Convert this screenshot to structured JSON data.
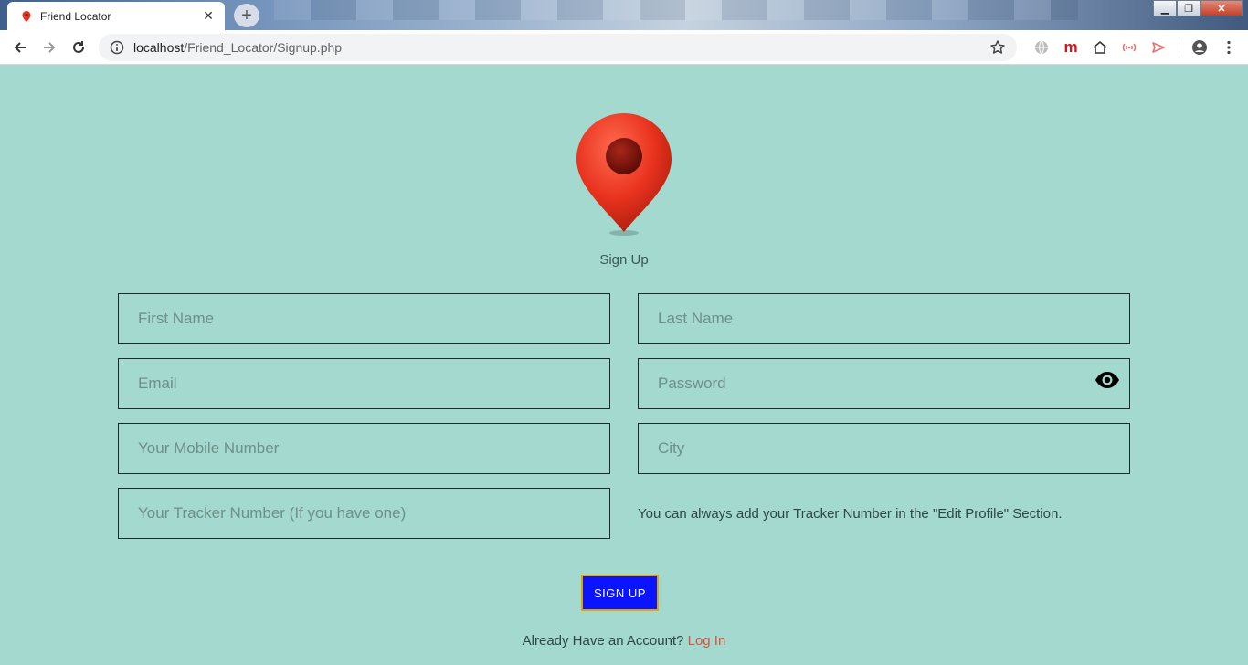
{
  "browser": {
    "tab_title": "Friend Locator",
    "tab_close": "✕",
    "new_tab": "+",
    "url_host": "localhost",
    "url_path": "/Friend_Locator/Signup.php",
    "extension_m_label": "m"
  },
  "page": {
    "heading": "Sign Up",
    "fields": {
      "first_name": "First Name",
      "last_name": "Last Name",
      "email": "Email",
      "password": "Password",
      "mobile": "Your Mobile Number",
      "city": "City",
      "tracker": "Your Tracker Number (If you have one)"
    },
    "tracker_note": "You can always add your Tracker Number in the \"Edit Profile\" Section.",
    "signup_button": "SIGN UP",
    "footer_text": "Already Have an Account?",
    "login_link": "Log In"
  },
  "colors": {
    "page_bg": "#a3d9cf",
    "button_bg": "#0a14ff",
    "button_border": "#e0a500",
    "link": "#d9533a",
    "pin": "#e8321e"
  }
}
